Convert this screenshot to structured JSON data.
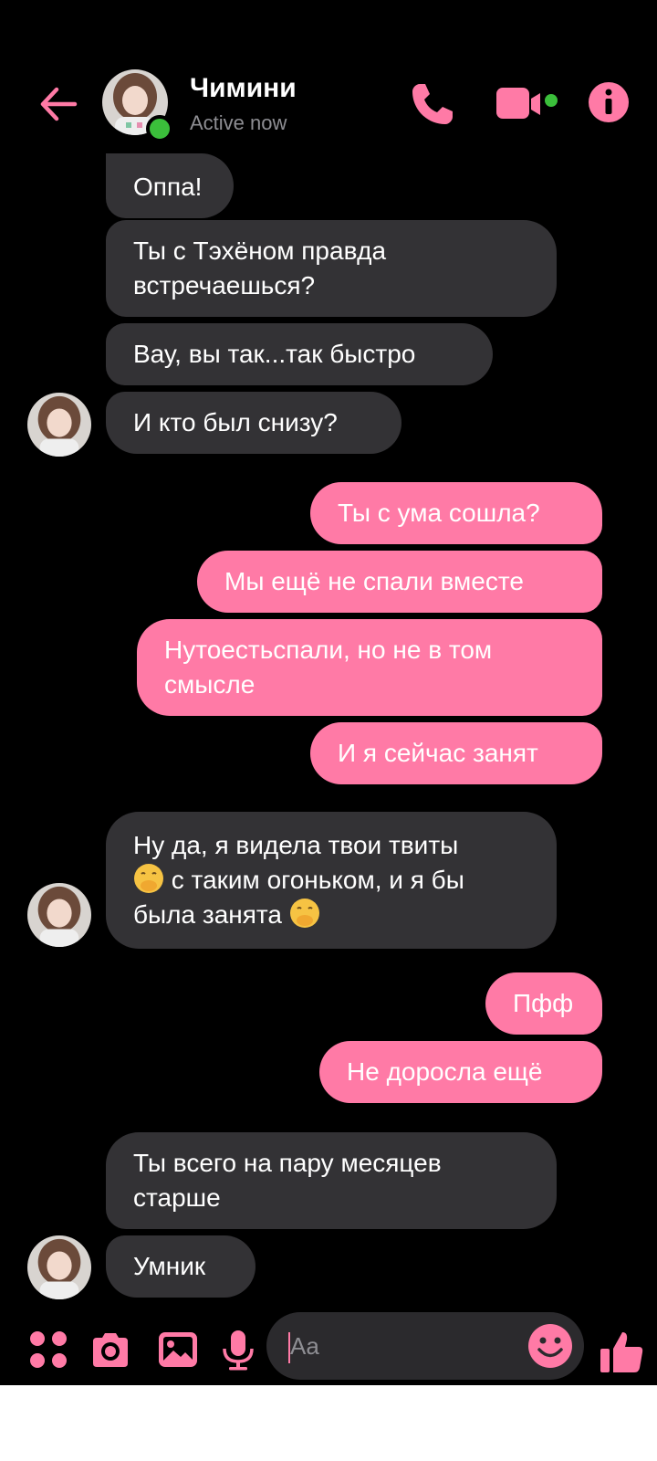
{
  "header": {
    "contact_name": "Чимини",
    "status": "Active now"
  },
  "messages": [
    {
      "side": "in",
      "text": "Оппа!"
    },
    {
      "side": "in",
      "text": "Ты с Тэхёном правда встречаешься?"
    },
    {
      "side": "in",
      "text": "Вау, вы так...так быстро"
    },
    {
      "side": "in",
      "text": "И кто был снизу?"
    },
    {
      "side": "out",
      "text": "Ты с ума сошла?"
    },
    {
      "side": "out",
      "text": "Мы ещё не спали вместе"
    },
    {
      "side": "out",
      "text": "Нутоестьспали, но не в том смысле"
    },
    {
      "side": "out",
      "text": "И я сейчас занят"
    },
    {
      "side": "in",
      "text_a": "Ну да, я видела твои твиты",
      "text_b": "с таким огоньком, и я бы была занята",
      "emoji": "face-with-hand-over-mouth"
    },
    {
      "side": "out",
      "text": "Пфф"
    },
    {
      "side": "out",
      "text": "Не доросла ещё"
    },
    {
      "side": "in",
      "text": "Ты всего на пару месяцев старше"
    },
    {
      "side": "in",
      "text": "Умник"
    }
  ],
  "composer": {
    "placeholder": "Aa"
  },
  "colors": {
    "accent": "#ff7aa6",
    "incoming_bubble": "#333235",
    "background": "#000000",
    "online": "#3bbf3b"
  },
  "icons": [
    "back-arrow-icon",
    "phone-icon",
    "video-camera-icon",
    "info-icon",
    "apps-icon",
    "camera-icon",
    "image-icon",
    "microphone-icon",
    "smiley-icon",
    "thumbs-up-icon"
  ]
}
